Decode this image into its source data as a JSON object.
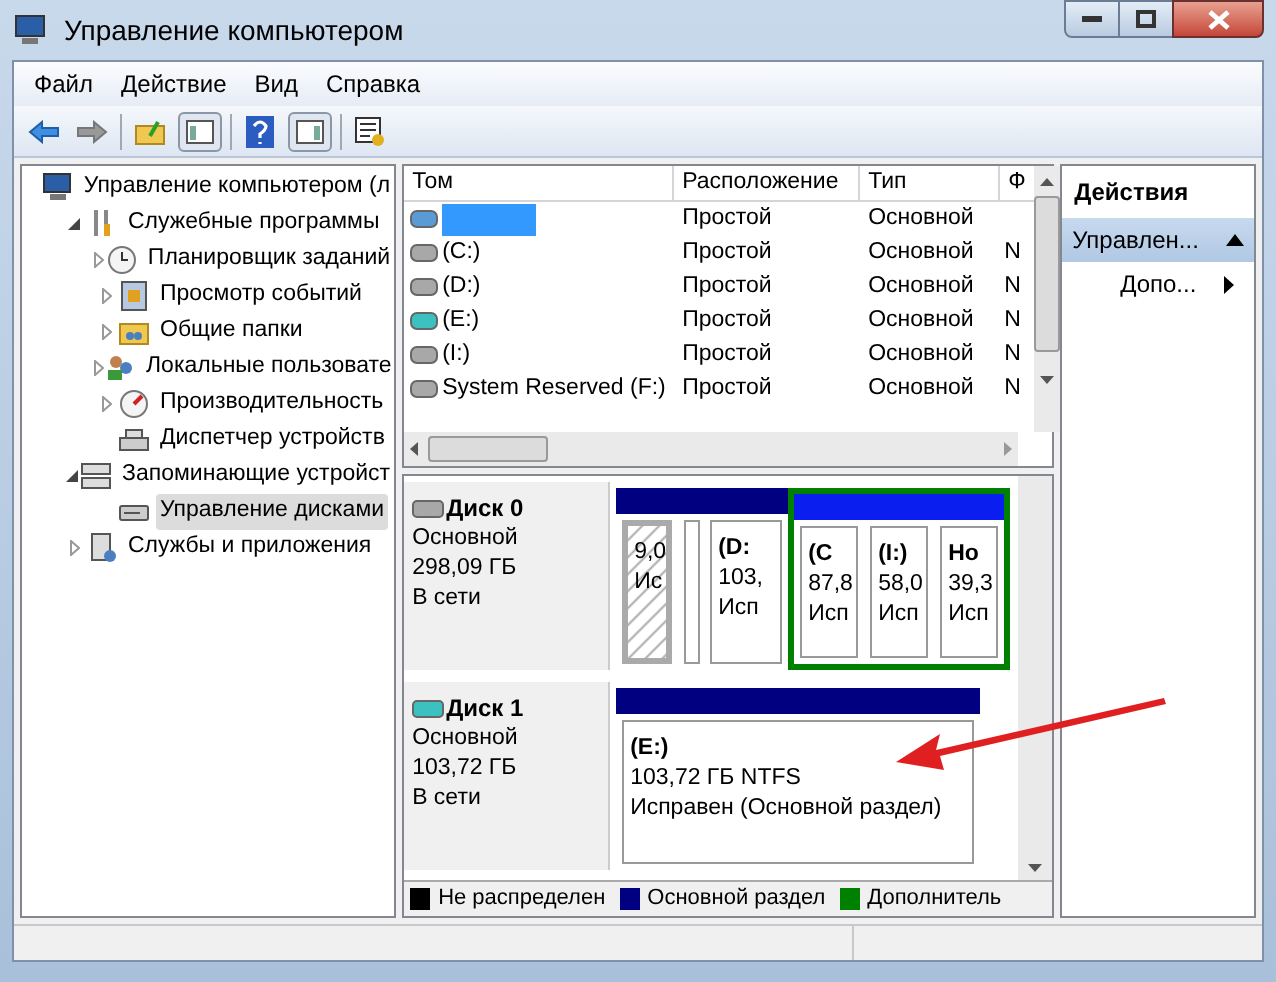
{
  "window": {
    "title": "Управление компьютером"
  },
  "menu": [
    {
      "label": "Файл"
    },
    {
      "label": "Действие"
    },
    {
      "label": "Вид"
    },
    {
      "label": "Справка"
    }
  ],
  "tree": [
    {
      "label": "Управление компьютером (л",
      "kind": "computer",
      "children": [
        {
          "label": "Служебные программы",
          "kind": "tools",
          "expanded": true,
          "selected": false,
          "children": [
            {
              "label": "Планировщик заданий",
              "kind": "clock",
              "expanded": false,
              "selected": false
            },
            {
              "label": "Просмотр событий",
              "kind": "log",
              "expanded": false,
              "selected": false
            },
            {
              "label": "Общие папки",
              "kind": "folder",
              "expanded": false,
              "selected": false
            },
            {
              "label": "Локальные пользовате",
              "kind": "users",
              "expanded": false,
              "selected": false
            },
            {
              "label": "Производительность",
              "kind": "gauge",
              "expanded": false,
              "selected": false
            },
            {
              "label": "Диспетчер устройств",
              "kind": "device",
              "selected": false
            }
          ]
        },
        {
          "label": "Запоминающие устройст",
          "kind": "storage",
          "expanded": true,
          "selected": false,
          "children": [
            {
              "label": "Управление дисками",
              "kind": "disk",
              "selected": true
            }
          ]
        },
        {
          "label": "Службы и приложения",
          "kind": "services",
          "expanded": false,
          "selected": false
        }
      ]
    }
  ],
  "table": {
    "columns": [
      "Том",
      "Расположение",
      "Тип",
      "Ф"
    ],
    "rows": [
      {
        "kind": "redacted",
        "color": "#5b9bd5",
        "layout": "Простой",
        "type": "Основной"
      },
      {
        "kind": "drive",
        "color": "#a8a8a8",
        "volume": "(C:)",
        "layout": "Простой",
        "type": "Основной",
        "column_4": "N"
      },
      {
        "kind": "drive",
        "color": "#a8a8a8",
        "volume": "(D:)",
        "layout": "Простой",
        "type": "Основной",
        "column_4": "N"
      },
      {
        "kind": "drive",
        "color": "#3cc0c0",
        "volume": "(E:)",
        "layout": "Простой",
        "type": "Основной",
        "column_4": "N"
      },
      {
        "kind": "drive",
        "color": "#a8a8a8",
        "volume": "(I:)",
        "layout": "Простой",
        "type": "Основной",
        "column_4": "N"
      },
      {
        "kind": "drive",
        "color": "#a8a8a8",
        "volume": "System Reserved (F:)",
        "layout": "Простой",
        "type": "Основной",
        "column_4": "N"
      }
    ]
  },
  "disks": [
    {
      "name": "Диск 0",
      "color": "#a8a8a8",
      "type": "Основной",
      "size": "298,09 ГБ",
      "status": "В сети",
      "partitions": [
        {
          "kind": "unallocated",
          "lines": [
            "9,0",
            "Ис"
          ]
        },
        {
          "kind": "primary"
        },
        {
          "kind": "primary",
          "lines": [
            "(D:",
            "103,",
            "Исп"
          ]
        },
        {
          "kind": "extended",
          "children": [
            {
              "kind": "logical",
              "lines": [
                "(C",
                "87,8",
                "Исп"
              ]
            },
            {
              "kind": "logical",
              "lines": [
                "(I:)",
                "58,0",
                "Исп"
              ]
            },
            {
              "kind": "logical",
              "lines": [
                "Но",
                "39,3",
                "Исп"
              ]
            }
          ]
        }
      ]
    },
    {
      "name": "Диск 1",
      "color": "#3cc0c0",
      "type": "Основной",
      "size": "103,72 ГБ",
      "status": "В сети",
      "partitions": [
        {
          "kind": "primary",
          "lines": [
            "(E:)",
            "103,72 ГБ NTFS",
            "Исправен (Основной раздел)"
          ]
        }
      ]
    }
  ],
  "legend": [
    {
      "label": "Не распределен",
      "color": "#000000"
    },
    {
      "label": "Основной раздел",
      "color": "#000080"
    },
    {
      "label": "Дополнитель",
      "color": "#008000"
    }
  ],
  "actions": {
    "title": "Действия",
    "items": [
      {
        "kind": "group",
        "label": "Управлен..."
      },
      {
        "kind": "link",
        "label": "Допо..."
      }
    ]
  }
}
